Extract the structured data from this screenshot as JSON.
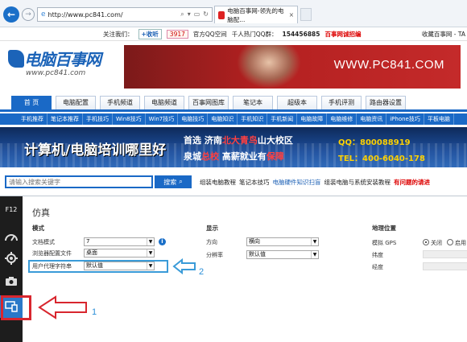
{
  "browser": {
    "url": "http://www.pc841.com/",
    "tab_title": "电脑百事网-领先的电脑配...",
    "tab_close": "×"
  },
  "utilbar": {
    "follow_label": "关注我们：",
    "weibo_follow": "+收听",
    "follower_count": "3917",
    "official_qq": "官方QQ空间",
    "qq_group_label": "千人热门QQ群：",
    "qq_group": "154456885",
    "recruit": "百事网诚招编",
    "bookmark": "收藏百事网 - TA"
  },
  "header": {
    "logo_text": "电脑百事网",
    "logo_sub": "www.pc841.com",
    "banner_site": "WWW.PC841.COM"
  },
  "main_nav": [
    "首 页",
    "电脑配置",
    "手机频道",
    "电脑频道",
    "百事网图库",
    "笔记本",
    "超级本",
    "手机评测",
    "路由器设置"
  ],
  "sub_nav": [
    "手机推荐",
    "笔记本推荐",
    "手机技巧",
    "Win8技巧",
    "Win7技巧",
    "电脑技巧",
    "电脑知识",
    "手机知识",
    "手机新闻",
    "电脑故障",
    "电脑维修",
    "电脑资讯",
    "iPhone技巧",
    "平板电脑"
  ],
  "ad": {
    "headline": "计算机/电脑培训哪里好",
    "line1_a": "首选 济南",
    "line1_b": "北大青鸟",
    "line1_c": "山大校区",
    "line2_a": "泉城",
    "line2_b": "总校",
    "line2_c": " 高薪就业有",
    "line2_d": "保障",
    "qq": "QQ：800088919",
    "tel": "TEL：400-6040-178"
  },
  "search": {
    "placeholder": "请输入搜索关键字",
    "button": "搜索",
    "links": [
      {
        "text": "组装电脑教程",
        "style": "normal"
      },
      {
        "text": "笔记本技巧",
        "style": "normal"
      },
      {
        "text": "电脑硬件知识扫盲",
        "style": "blue"
      },
      {
        "text": "组装电脑与系统安装教程",
        "style": "normal"
      },
      {
        "text": "有问题的请进",
        "style": "red"
      }
    ]
  },
  "devtools": {
    "f12": "F12",
    "title": "仿真",
    "mode_header": "模式",
    "display_header": "显示",
    "geo_header": "地理位置",
    "doc_mode_label": "文档模式",
    "doc_mode_value": "7",
    "browser_profile_label": "浏览器配置文件",
    "browser_profile_value": "桌面",
    "ua_label": "用户代理字符串",
    "ua_value": "默认值",
    "orientation_label": "方向",
    "orientation_value": "横向",
    "resolution_label": "分辨率",
    "resolution_value": "默认值",
    "gps_label": "模拟 GPS",
    "gps_off": "关闭",
    "gps_on": "启用",
    "gps_selected": "关闭",
    "latitude_label": "纬度",
    "longitude_label": "经度"
  },
  "annotations": {
    "callout_2": "2",
    "callout_1": "1"
  },
  "colors": {
    "site_blue": "#1a69c6",
    "ie_blue": "#1a6fc8",
    "annotation_red": "#d8262e",
    "annotation_blue": "#3a9bd8"
  },
  "icons": {
    "back": "arrow-left-icon",
    "forward": "arrow-right-icon",
    "devtools_side": [
      "performance-gauge-icon",
      "settings-gear-icon",
      "camera-icon",
      "emulation-devices-icon"
    ]
  }
}
